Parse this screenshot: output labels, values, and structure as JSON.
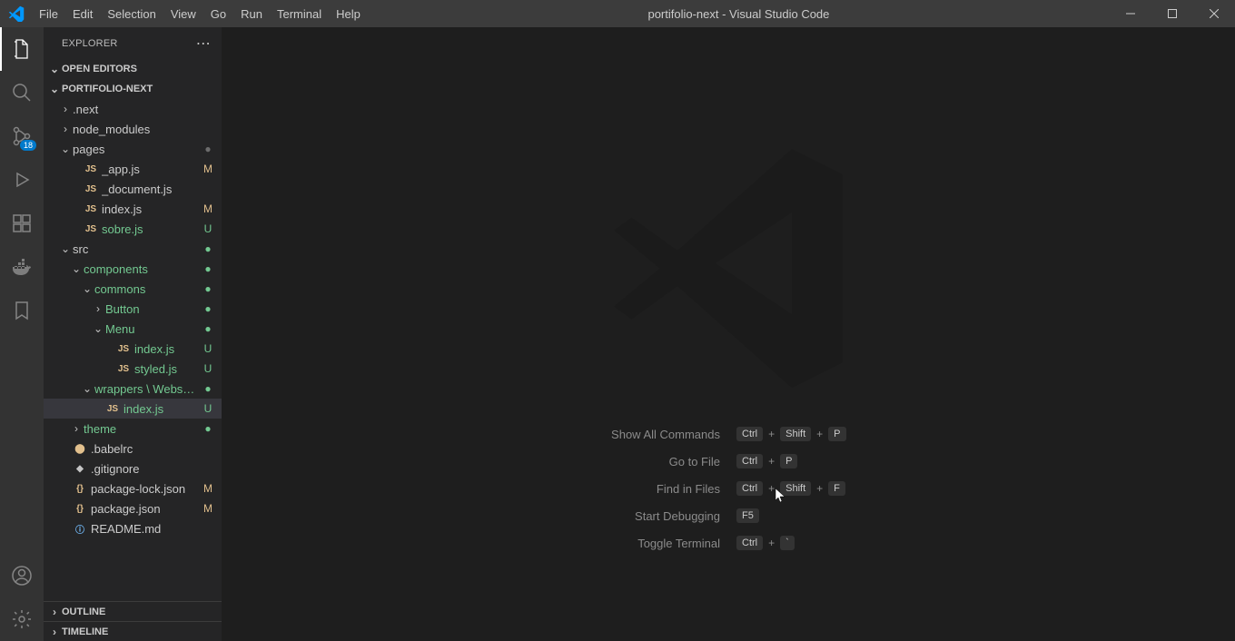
{
  "title": "portifolio-next - Visual Studio Code",
  "menu": [
    "File",
    "Edit",
    "Selection",
    "View",
    "Go",
    "Run",
    "Terminal",
    "Help"
  ],
  "activity": {
    "scm_badge": "18"
  },
  "sidebar": {
    "title": "EXPLORER",
    "sections": {
      "open_editors": "OPEN EDITORS",
      "project": "PORTIFOLIO-NEXT",
      "outline": "OUTLINE",
      "timeline": "TIMELINE"
    }
  },
  "tree": [
    {
      "indent": 1,
      "twistie": ">",
      "label": ".next"
    },
    {
      "indent": 1,
      "twistie": ">",
      "label": "node_modules"
    },
    {
      "indent": 1,
      "twistie": "v",
      "label": "pages",
      "badge": "dot"
    },
    {
      "indent": 2,
      "icon": "JS",
      "iconClass": "ic-js",
      "label": "_app.js",
      "badge": "M"
    },
    {
      "indent": 2,
      "icon": "JS",
      "iconClass": "ic-js",
      "label": "_document.js"
    },
    {
      "indent": 2,
      "icon": "JS",
      "iconClass": "ic-js",
      "label": "index.js",
      "badge": "M"
    },
    {
      "indent": 2,
      "icon": "JS",
      "iconClass": "ic-js",
      "label": "sobre.js",
      "badge": "U",
      "green": true
    },
    {
      "indent": 1,
      "twistie": "v",
      "label": "src",
      "badge": "dotg"
    },
    {
      "indent": 2,
      "twistie": "v",
      "label": "components",
      "green": true,
      "badge": "dotg"
    },
    {
      "indent": 3,
      "twistie": "v",
      "label": "commons",
      "green": true,
      "badge": "dotg"
    },
    {
      "indent": 4,
      "twistie": ">",
      "label": "Button",
      "green": true,
      "badge": "dotg"
    },
    {
      "indent": 4,
      "twistie": "v",
      "label": "Menu",
      "green": true,
      "badge": "dotg"
    },
    {
      "indent": 5,
      "icon": "JS",
      "iconClass": "ic-js",
      "label": "index.js",
      "badge": "U",
      "green": true
    },
    {
      "indent": 5,
      "icon": "JS",
      "iconClass": "ic-js",
      "label": "styled.js",
      "badge": "U",
      "green": true
    },
    {
      "indent": 3,
      "twistie": "v",
      "label": "wrappers \\ Websit...",
      "green": true,
      "badge": "dotg"
    },
    {
      "indent": 4,
      "icon": "JS",
      "iconClass": "ic-js",
      "label": "index.js",
      "badge": "U",
      "green": true,
      "selected": true
    },
    {
      "indent": 2,
      "twistie": ">",
      "label": "theme",
      "green": true,
      "badge": "dotg"
    },
    {
      "indent": 1,
      "icon": "⬤",
      "iconClass": "ic-js",
      "label": ".babelrc"
    },
    {
      "indent": 1,
      "icon": "◆",
      "iconClass": "ic-gray",
      "label": ".gitignore"
    },
    {
      "indent": 1,
      "icon": "{}",
      "iconClass": "ic-json",
      "label": "package-lock.json",
      "badge": "M"
    },
    {
      "indent": 1,
      "icon": "{}",
      "iconClass": "ic-json",
      "label": "package.json",
      "badge": "M"
    },
    {
      "indent": 1,
      "icon": "ⓘ",
      "iconClass": "ic-info",
      "label": "README.md"
    }
  ],
  "welcome": [
    {
      "label": "Show All Commands",
      "keys": [
        "Ctrl",
        "+",
        "Shift",
        "+",
        "P"
      ]
    },
    {
      "label": "Go to File",
      "keys": [
        "Ctrl",
        "+",
        "P"
      ]
    },
    {
      "label": "Find in Files",
      "keys": [
        "Ctrl",
        "+",
        "Shift",
        "+",
        "F"
      ]
    },
    {
      "label": "Start Debugging",
      "keys": [
        "F5"
      ]
    },
    {
      "label": "Toggle Terminal",
      "keys": [
        "Ctrl",
        "+",
        "`"
      ]
    }
  ]
}
